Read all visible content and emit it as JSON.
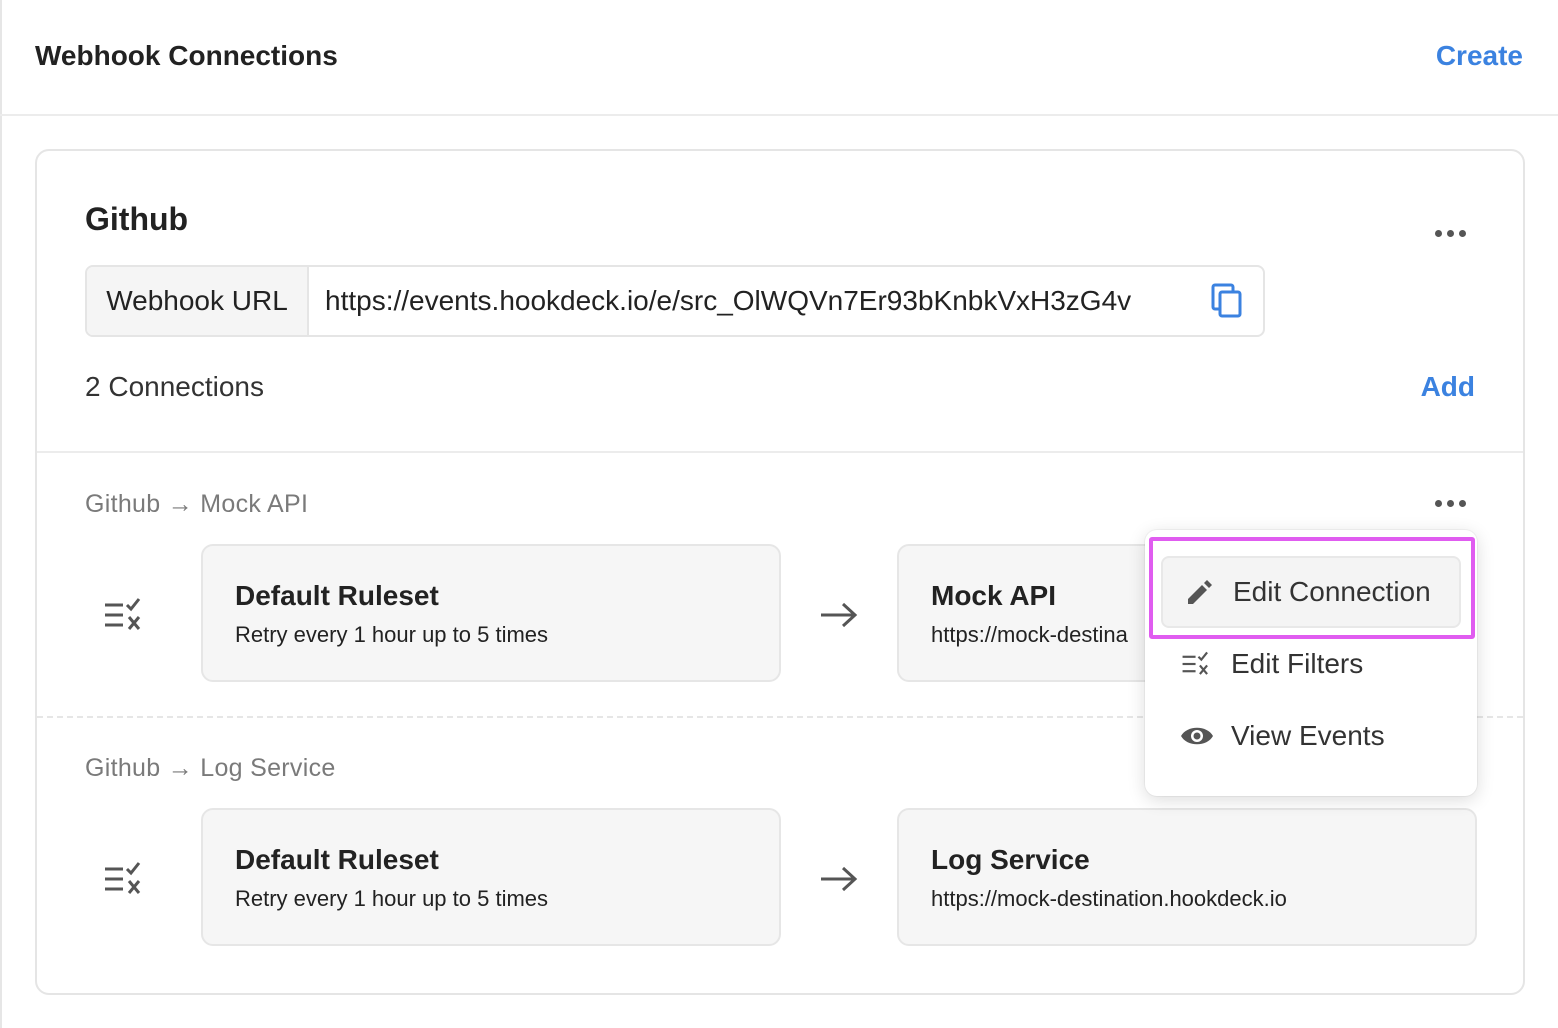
{
  "header": {
    "title": "Webhook Connections",
    "create_label": "Create"
  },
  "source": {
    "name": "Github",
    "webhook_url_label": "Webhook URL",
    "webhook_url": "https://events.hookdeck.io/e/src_OlWQVn7Er93bKnbkVxH3zG4v",
    "connections_count": "2 Connections",
    "add_label": "Add"
  },
  "connections": [
    {
      "label": "Github → Mock API",
      "ruleset_title": "Default Ruleset",
      "ruleset_desc": "Retry every 1 hour up to 5 times",
      "destination_title": "Mock API",
      "destination_url": "https://mock-destina"
    },
    {
      "label": "Github → Log Service",
      "ruleset_title": "Default Ruleset",
      "ruleset_desc": "Retry every 1 hour up to 5 times",
      "destination_title": "Log Service",
      "destination_url": "https://mock-destination.hookdeck.io"
    }
  ],
  "context_menu": {
    "items": [
      {
        "label": "Edit Connection",
        "icon": "pencil-icon"
      },
      {
        "label": "Edit Filters",
        "icon": "filter-icon"
      },
      {
        "label": "View Events",
        "icon": "eye-icon"
      }
    ]
  },
  "colors": {
    "accent": "#3b82e0",
    "highlight": "#e05cf0"
  }
}
